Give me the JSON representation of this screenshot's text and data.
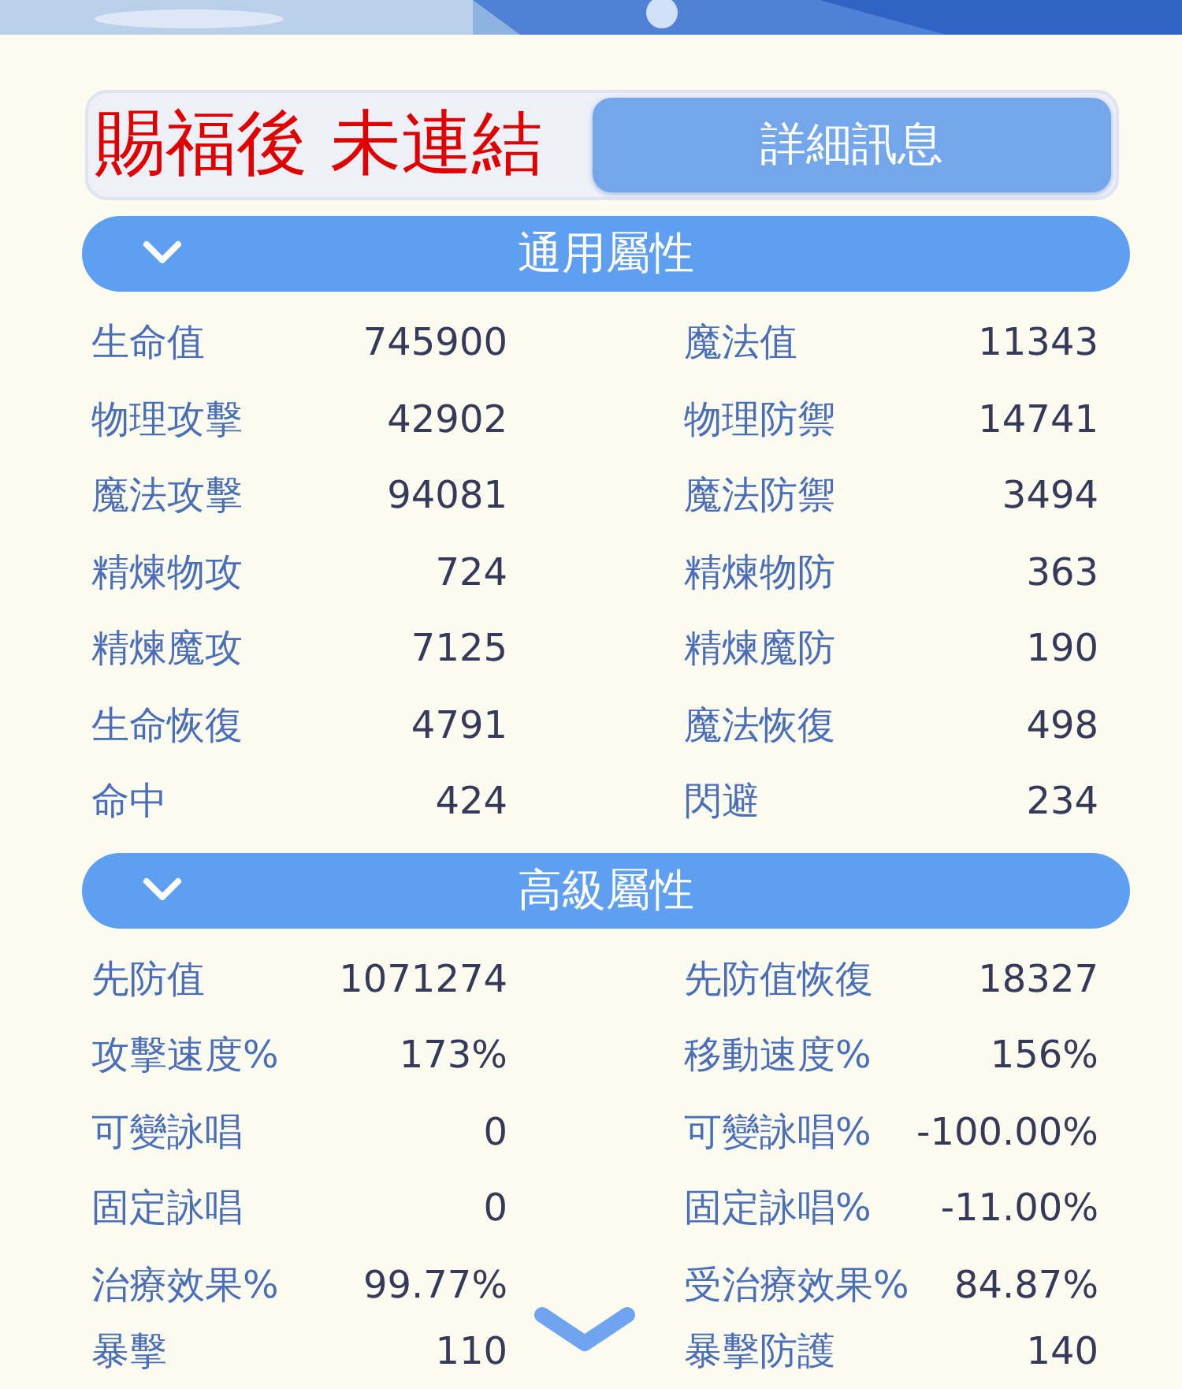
{
  "annotation": "賜福後 未連結",
  "tabs": [
    {
      "label": "詳細訊息",
      "selected": true
    }
  ],
  "sections": [
    {
      "title": "通用屬性",
      "expanded": true,
      "rows": [
        {
          "left_label": "生命值",
          "left_value": "745900",
          "right_label": "魔法值",
          "right_value": "11343"
        },
        {
          "left_label": "物理攻擊",
          "left_value": "42902",
          "right_label": "物理防禦",
          "right_value": "14741"
        },
        {
          "left_label": "魔法攻擊",
          "left_value": "94081",
          "right_label": "魔法防禦",
          "right_value": "3494"
        },
        {
          "left_label": "精煉物攻",
          "left_value": "724",
          "right_label": "精煉物防",
          "right_value": "363"
        },
        {
          "left_label": "精煉魔攻",
          "left_value": "7125",
          "right_label": "精煉魔防",
          "right_value": "190"
        },
        {
          "left_label": "生命恢復",
          "left_value": "4791",
          "right_label": "魔法恢復",
          "right_value": "498"
        },
        {
          "left_label": "命中",
          "left_value": "424",
          "right_label": "閃避",
          "right_value": "234"
        }
      ]
    },
    {
      "title": "高級屬性",
      "expanded": true,
      "rows": [
        {
          "left_label": "先防值",
          "left_value": "1071274",
          "right_label": "先防值恢復",
          "right_value": "18327"
        },
        {
          "left_label": "攻擊速度%",
          "left_value": "173%",
          "right_label": "移動速度%",
          "right_value": "156%"
        },
        {
          "left_label": "可變詠唱",
          "left_value": "0",
          "right_label": "可變詠唱%",
          "right_value": "-100.00%"
        },
        {
          "left_label": "固定詠唱",
          "left_value": "0",
          "right_label": "固定詠唱%",
          "right_value": "-11.00%"
        },
        {
          "left_label": "治療效果%",
          "left_value": "99.77%",
          "right_label": "受治療效果%",
          "right_value": "84.87%"
        },
        {
          "left_label": "暴擊",
          "left_value": "110",
          "right_label": "暴擊防護",
          "right_value": "140"
        }
      ]
    }
  ]
}
